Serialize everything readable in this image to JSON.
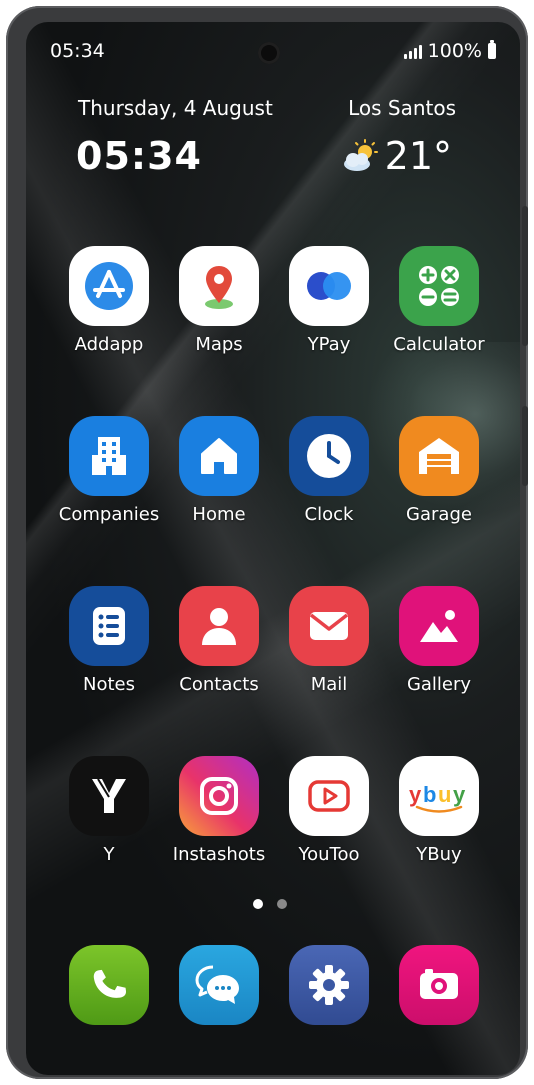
{
  "status_bar": {
    "time": "05:34",
    "battery": "100%"
  },
  "widget": {
    "date": "Thursday, 4 August",
    "time": "05:34",
    "location": "Los Santos",
    "temperature": "21°"
  },
  "apps": [
    {
      "label": "Addapp",
      "icon": "app-store-icon",
      "color": "#2c8be8"
    },
    {
      "label": "Maps",
      "icon": "map-pin-icon",
      "color": "#e24a3b"
    },
    {
      "label": "YPay",
      "icon": "pay-circles-icon",
      "color": "#2b4ecb"
    },
    {
      "label": "Calculator",
      "icon": "calculator-icon",
      "color": "#3ba34b"
    },
    {
      "label": "Companies",
      "icon": "building-icon",
      "color": "#1a7fe0"
    },
    {
      "label": "Home",
      "icon": "house-icon",
      "color": "#1a7fe0"
    },
    {
      "label": "Clock",
      "icon": "clock-icon",
      "color": "#154d9a"
    },
    {
      "label": "Garage",
      "icon": "garage-icon",
      "color": "#f08a1f"
    },
    {
      "label": "Notes",
      "icon": "notes-list-icon",
      "color": "#154d9a"
    },
    {
      "label": "Contacts",
      "icon": "person-icon",
      "color": "#e8424a"
    },
    {
      "label": "Mail",
      "icon": "envelope-icon",
      "color": "#e8424a"
    },
    {
      "label": "Gallery",
      "icon": "image-icon",
      "color": "#e0127a"
    },
    {
      "label": "Y",
      "icon": "y-logo-icon",
      "color": "#111111"
    },
    {
      "label": "Instashots",
      "icon": "camera-square-icon",
      "color": "#e0338a"
    },
    {
      "label": "YouToo",
      "icon": "play-button-icon",
      "color": "#e53935"
    },
    {
      "label": "YBuy",
      "icon": "ybuy-logo-icon",
      "color": "#ffffff"
    }
  ],
  "dock": [
    {
      "name": "phone",
      "icon": "phone-icon",
      "color": "#5aaa1e"
    },
    {
      "name": "messages",
      "icon": "chat-bubbles-icon",
      "color": "#1e9ad6"
    },
    {
      "name": "settings",
      "icon": "gear-icon",
      "color": "#3b55a0"
    },
    {
      "name": "camera",
      "icon": "camera-icon",
      "color": "#e0127a"
    }
  ],
  "page_indicator": {
    "pages": 2,
    "current": 1
  }
}
